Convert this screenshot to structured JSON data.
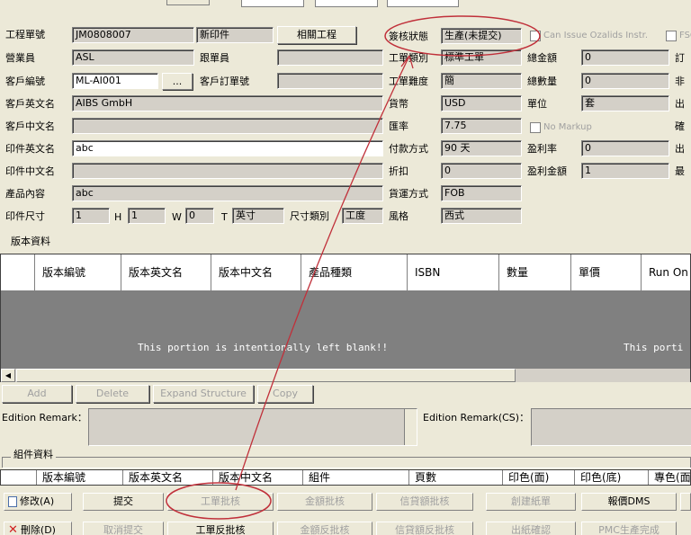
{
  "form": {
    "job_no": {
      "label": "工程單號",
      "value": "JM0808007"
    },
    "print_status": {
      "value": "新印件"
    },
    "related_button": "相關工程",
    "salesperson": {
      "label": "營業員",
      "value": "ASL"
    },
    "follower": {
      "label": "跟單員",
      "value": ""
    },
    "customer_code": {
      "label": "客戶編號",
      "value": "ML-AI001"
    },
    "customer_po": {
      "label": "客戶訂單號",
      "value": ""
    },
    "customer_en": {
      "label": "客戶英文名",
      "value": "AIBS GmbH"
    },
    "customer_cn": {
      "label": "客戶中文名",
      "value": ""
    },
    "print_en": {
      "label": "印件英文名",
      "value": "abc"
    },
    "print_cn": {
      "label": "印件中文名",
      "value": ""
    },
    "product_content": {
      "label": "產品內容",
      "value": "abc"
    },
    "size": {
      "label": "印件尺寸",
      "l": "1",
      "h_label": "H",
      "h": "1",
      "w_label": "W",
      "w": "0",
      "t_label": "T",
      "unit": "英寸"
    },
    "size_category": {
      "label": "尺寸類別",
      "value": "工度"
    },
    "flow_status": {
      "label": "簽核狀態",
      "value": "生產(未提交)"
    },
    "can_issue": "Can Issue Ozalids Instr.",
    "fsc": "FSC",
    "job_type": {
      "label": "工單類別",
      "value": "標準工單"
    },
    "total_amount": {
      "label": "總金額",
      "value": "0"
    },
    "difficulty": {
      "label": "工單難度",
      "value": "簡"
    },
    "total_qty": {
      "label": "總數量",
      "value": "0"
    },
    "currency": {
      "label": "貨幣",
      "value": "USD"
    },
    "unit": {
      "label": "單位",
      "value": "套"
    },
    "no_markup": "No Markup",
    "exchange_rate": {
      "label": "匯率",
      "value": "7.75"
    },
    "payment": {
      "label": "付款方式",
      "value": "90 天"
    },
    "profit_rate": {
      "label": "盈利率",
      "value": "0"
    },
    "discount": {
      "label": "折扣",
      "value": "0"
    },
    "profit_amount": {
      "label": "盈利金額",
      "value": "1"
    },
    "shipping": {
      "label": "貨運方式",
      "value": "FOB"
    },
    "style": {
      "label": "風格",
      "value": "西式"
    },
    "right_cut": [
      "訂",
      "非",
      "出",
      "確",
      "出",
      "最"
    ]
  },
  "edition": {
    "title": "版本資料",
    "columns": [
      "版本編號",
      "版本英文名",
      "版本中文名",
      "產品種類",
      "ISBN",
      "數量",
      "單價",
      "Run On"
    ],
    "blank_text": "This portion is intentionally left blank!!",
    "blank_text_2": "This porti",
    "buttons": [
      "Add",
      "Delete",
      "Expand Structure",
      "Copy"
    ],
    "remark_label": "Edition Remark：",
    "remark_cs_label": "Edition Remark(CS)："
  },
  "component": {
    "title": "組件資料",
    "columns": [
      "版本編號",
      "版本英文名",
      "版本中文名",
      "組件",
      "頁數",
      "印色(面)",
      "印色(底)",
      "專色(面)"
    ]
  },
  "toolbar": {
    "modify": "修改(A)",
    "delete": "刪除(D)",
    "submit": "提交",
    "job_approve": "工單批核",
    "amount_approve": "金額批核",
    "credit_approve": "信貸額批核",
    "create_paper": "創建紙單",
    "quote_dms": "報價DMS",
    "cancel_submit": "取消提交",
    "job_unapprove": "工單反批核",
    "amount_unapprove": "金額反批核",
    "credit_unapprove": "信貸額反批核",
    "confirm": "出紙確認",
    "pmc_done": "PMC生產完成"
  },
  "colors": {
    "annotation": "#c0303a",
    "blank_area": "#808080",
    "field_bg": "#d4d0c8"
  }
}
